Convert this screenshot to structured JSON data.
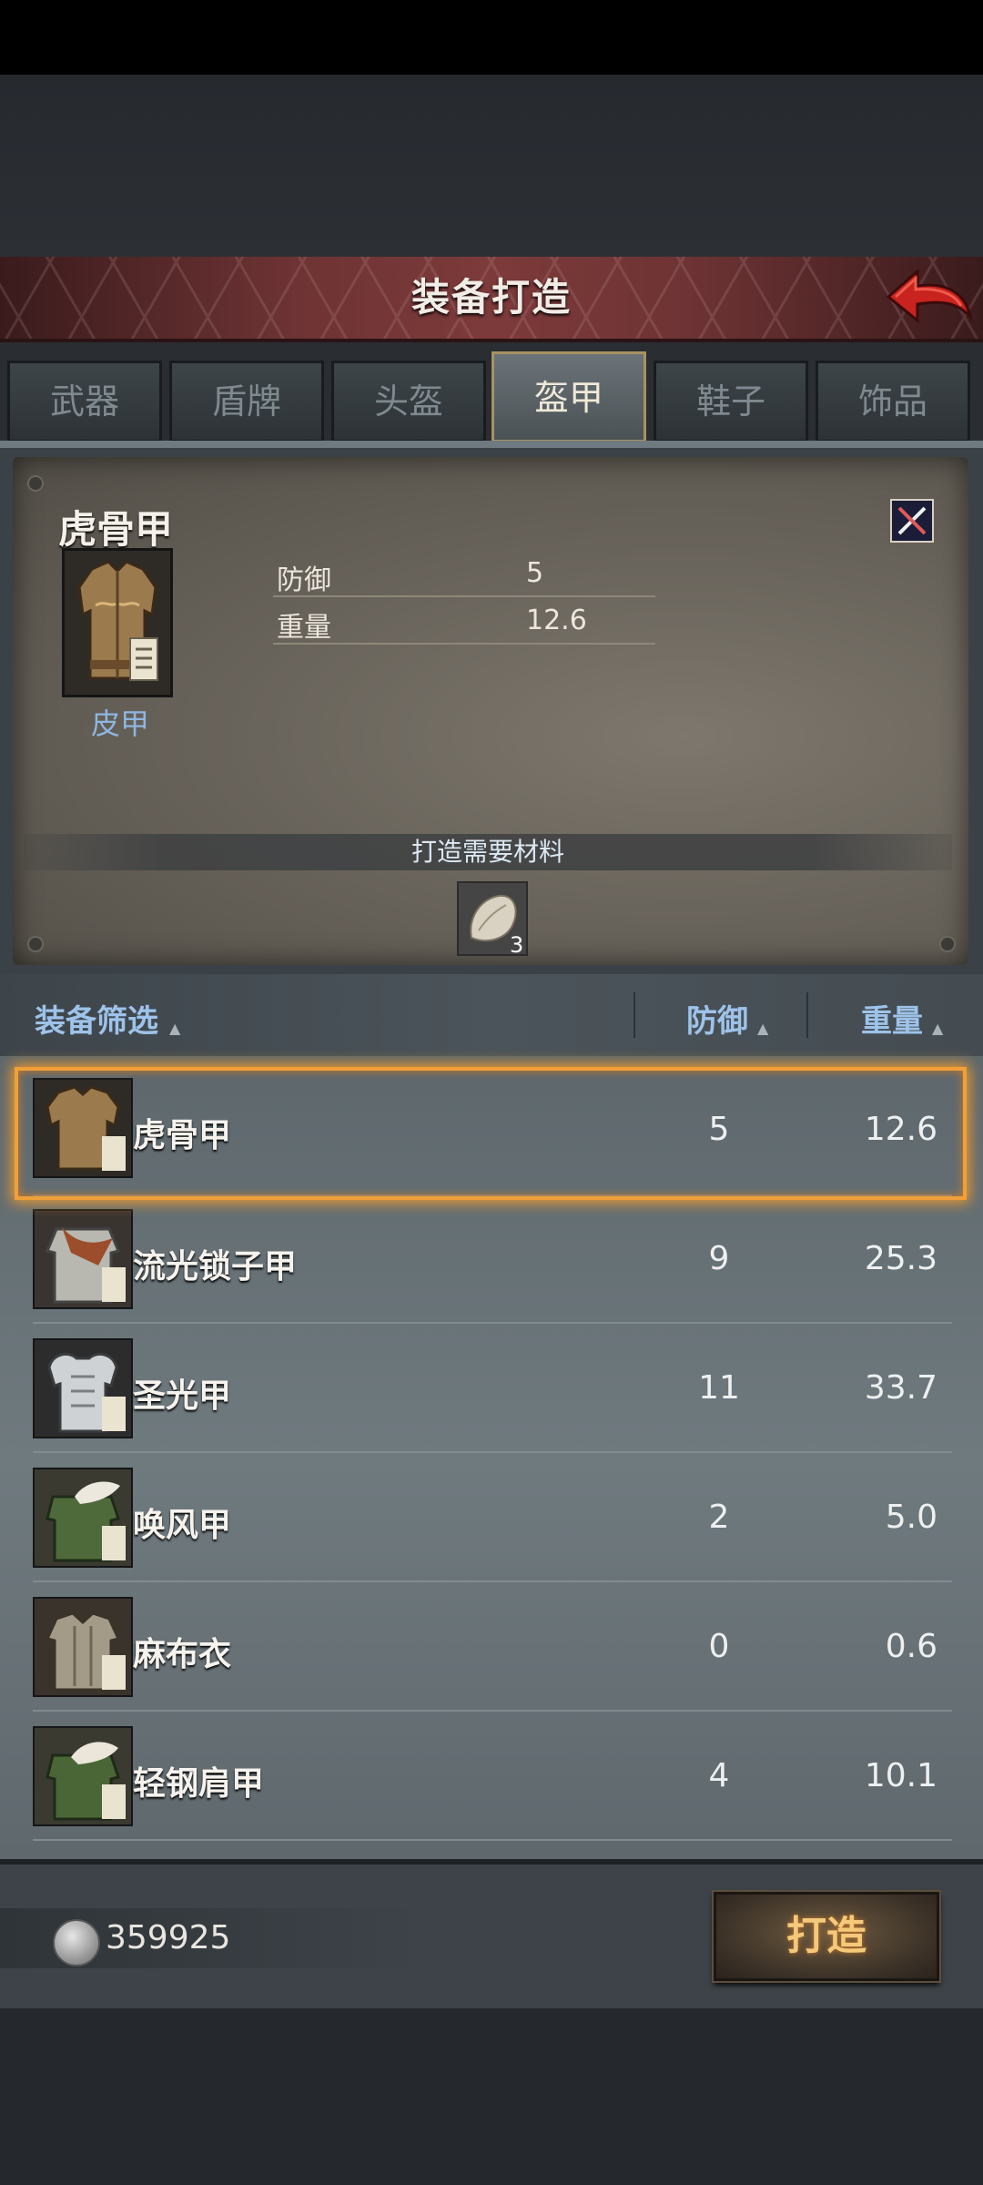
{
  "header": {
    "title": "装备打造"
  },
  "tabs": [
    {
      "label": "武器"
    },
    {
      "label": "盾牌"
    },
    {
      "label": "头盔"
    },
    {
      "label": "盔甲"
    },
    {
      "label": "鞋子"
    },
    {
      "label": "饰品"
    }
  ],
  "active_tab": "盔甲",
  "detail": {
    "name": "虎骨甲",
    "type": "皮甲",
    "stats": [
      {
        "label": "防御",
        "value": "5"
      },
      {
        "label": "重量",
        "value": "12.6"
      }
    ],
    "materials_title": "打造需要材料",
    "material_count": "3"
  },
  "filter": {
    "name_label": "装备筛选",
    "defense_label": "防御",
    "weight_label": "重量"
  },
  "items": [
    {
      "name": "虎骨甲",
      "defense": "5",
      "weight": "12.6",
      "icon": "leather-armor-icon"
    },
    {
      "name": "流光锁子甲",
      "defense": "9",
      "weight": "25.3",
      "icon": "chainmail-icon"
    },
    {
      "name": "圣光甲",
      "defense": "11",
      "weight": "33.7",
      "icon": "plate-armor-icon"
    },
    {
      "name": "唤风甲",
      "defense": "2",
      "weight": "5.0",
      "icon": "fur-tunic-icon"
    },
    {
      "name": "麻布衣",
      "defense": "0",
      "weight": "0.6",
      "icon": "cloth-shirt-icon"
    },
    {
      "name": "轻钢肩甲",
      "defense": "4",
      "weight": "10.1",
      "icon": "shoulder-armor-icon"
    }
  ],
  "footer": {
    "coins": "359925",
    "craft_label": "打造"
  },
  "colors": {
    "accent_gold": "#f0a03a",
    "header_red": "#7d3a3a",
    "link_blue": "#9ec3ea"
  }
}
